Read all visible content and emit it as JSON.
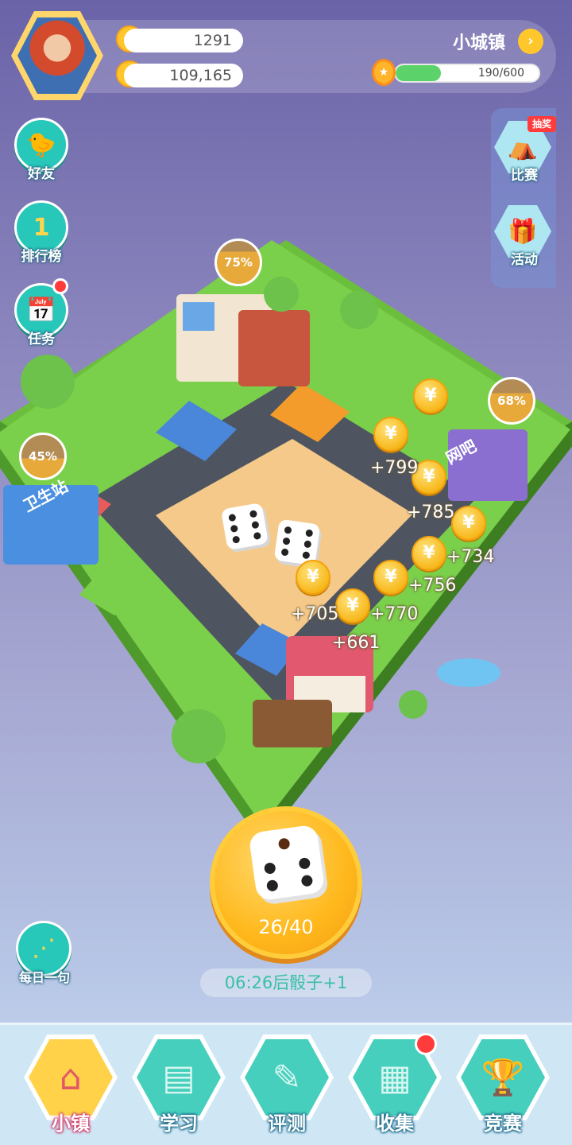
{
  "player": {
    "stars": "1291",
    "coins": "109,165"
  },
  "town": {
    "name": "小城镇",
    "xp_text": "190/600",
    "xp_fraction": 0.3167
  },
  "left_menu": [
    {
      "label": "好友",
      "icon": "chick-icon"
    },
    {
      "label": "排行榜",
      "icon": "trophy-rank-icon"
    },
    {
      "label": "任务",
      "icon": "calendar-task-icon"
    }
  ],
  "right_menu": {
    "lottery_tag": "抽奖",
    "items": [
      {
        "label": "比赛",
        "icon": "tent-icon"
      },
      {
        "label": "活动",
        "icon": "gift-icon"
      }
    ]
  },
  "board": {
    "sign_health_station": "卫生站",
    "sign_top_right": "网吧",
    "progress_bubbles": [
      {
        "text": "75%",
        "value": 0.75
      },
      {
        "text": "68%",
        "value": 0.68
      },
      {
        "text": "45%",
        "value": 0.45
      }
    ],
    "coin_gains": [
      "+799",
      "+785",
      "+734",
      "+756",
      "+770",
      "+705",
      "+661"
    ]
  },
  "dice": {
    "count": "26/40",
    "timer": "06:26后骰子+1"
  },
  "share": {
    "label": "每日一句"
  },
  "bottom_nav": [
    {
      "label": "小镇",
      "icon": "house-icon",
      "active": true
    },
    {
      "label": "学习",
      "icon": "books-icon",
      "active": false
    },
    {
      "label": "评测",
      "icon": "test-paper-icon",
      "active": false
    },
    {
      "label": "收集",
      "icon": "collection-box-icon",
      "active": false
    },
    {
      "label": "竞赛",
      "icon": "cup-icon",
      "active": false
    }
  ],
  "colors": {
    "accent_teal": "#27c7b9",
    "coin_gold": "#f7b81c",
    "grass": "#7ad04a",
    "road": "#4f5560",
    "notification_red": "#ff3b3b"
  }
}
